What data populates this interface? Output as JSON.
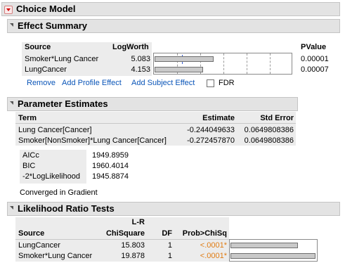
{
  "report": {
    "title": "Choice Model"
  },
  "effect_summary": {
    "title": "Effect Summary",
    "columns": {
      "source": "Source",
      "logworth": "LogWorth",
      "pvalue": "PValue"
    },
    "rows": [
      {
        "source": "Smoker*Lung Cancer",
        "logworth": "5.083",
        "logworth_value": 5.083,
        "pvalue": "0.00001"
      },
      {
        "source": "LungCancer",
        "logworth": "4.153",
        "logworth_value": 4.153,
        "pvalue": "0.00007"
      }
    ],
    "buttons": {
      "remove": "Remove",
      "add_profile": "Add Profile Effect",
      "add_subject": "Add Subject Effect",
      "fdr": "FDR"
    },
    "fdr_checked": false
  },
  "parameter_estimates": {
    "title": "Parameter Estimates",
    "columns": {
      "term": "Term",
      "estimate": "Estimate",
      "stderr": "Std Error"
    },
    "rows": [
      {
        "term": "Lung Cancer[Cancer]",
        "estimate": "-0.244049633",
        "stderr": "0.0649808386"
      },
      {
        "term": "Smoker[NonSmoker]*Lung Cancer[Cancer]",
        "estimate": "-0.272457870",
        "stderr": "0.0649808386"
      }
    ],
    "fit_stats": [
      {
        "label": "AICc",
        "value": "1949.8959"
      },
      {
        "label": "BIC",
        "value": "1960.4014"
      },
      {
        "label": "-2*LogLikelihood",
        "value": "1945.8874"
      }
    ],
    "converged": "Converged in Gradient"
  },
  "likelihood_ratio": {
    "title": "Likelihood Ratio Tests",
    "columns": {
      "source": "Source",
      "lr_line1": "L-R",
      "lr_line2": "ChiSquare",
      "df": "DF",
      "prob": "Prob>ChiSq"
    },
    "rows": [
      {
        "source": "LungCancer",
        "chisq": "15.803",
        "chisq_value": 15.803,
        "df": "1",
        "prob": "<.0001*"
      },
      {
        "source": "Smoker*Lung Cancer",
        "chisq": "19.878",
        "chisq_value": 19.878,
        "df": "1",
        "prob": "<.0001*"
      }
    ]
  },
  "colors": {
    "header_bg": "#e3e3e3",
    "table_bg": "#ececec",
    "link": "#0a55b8",
    "significant": "#e07b12",
    "bar_fill": "#c9c9c9"
  }
}
